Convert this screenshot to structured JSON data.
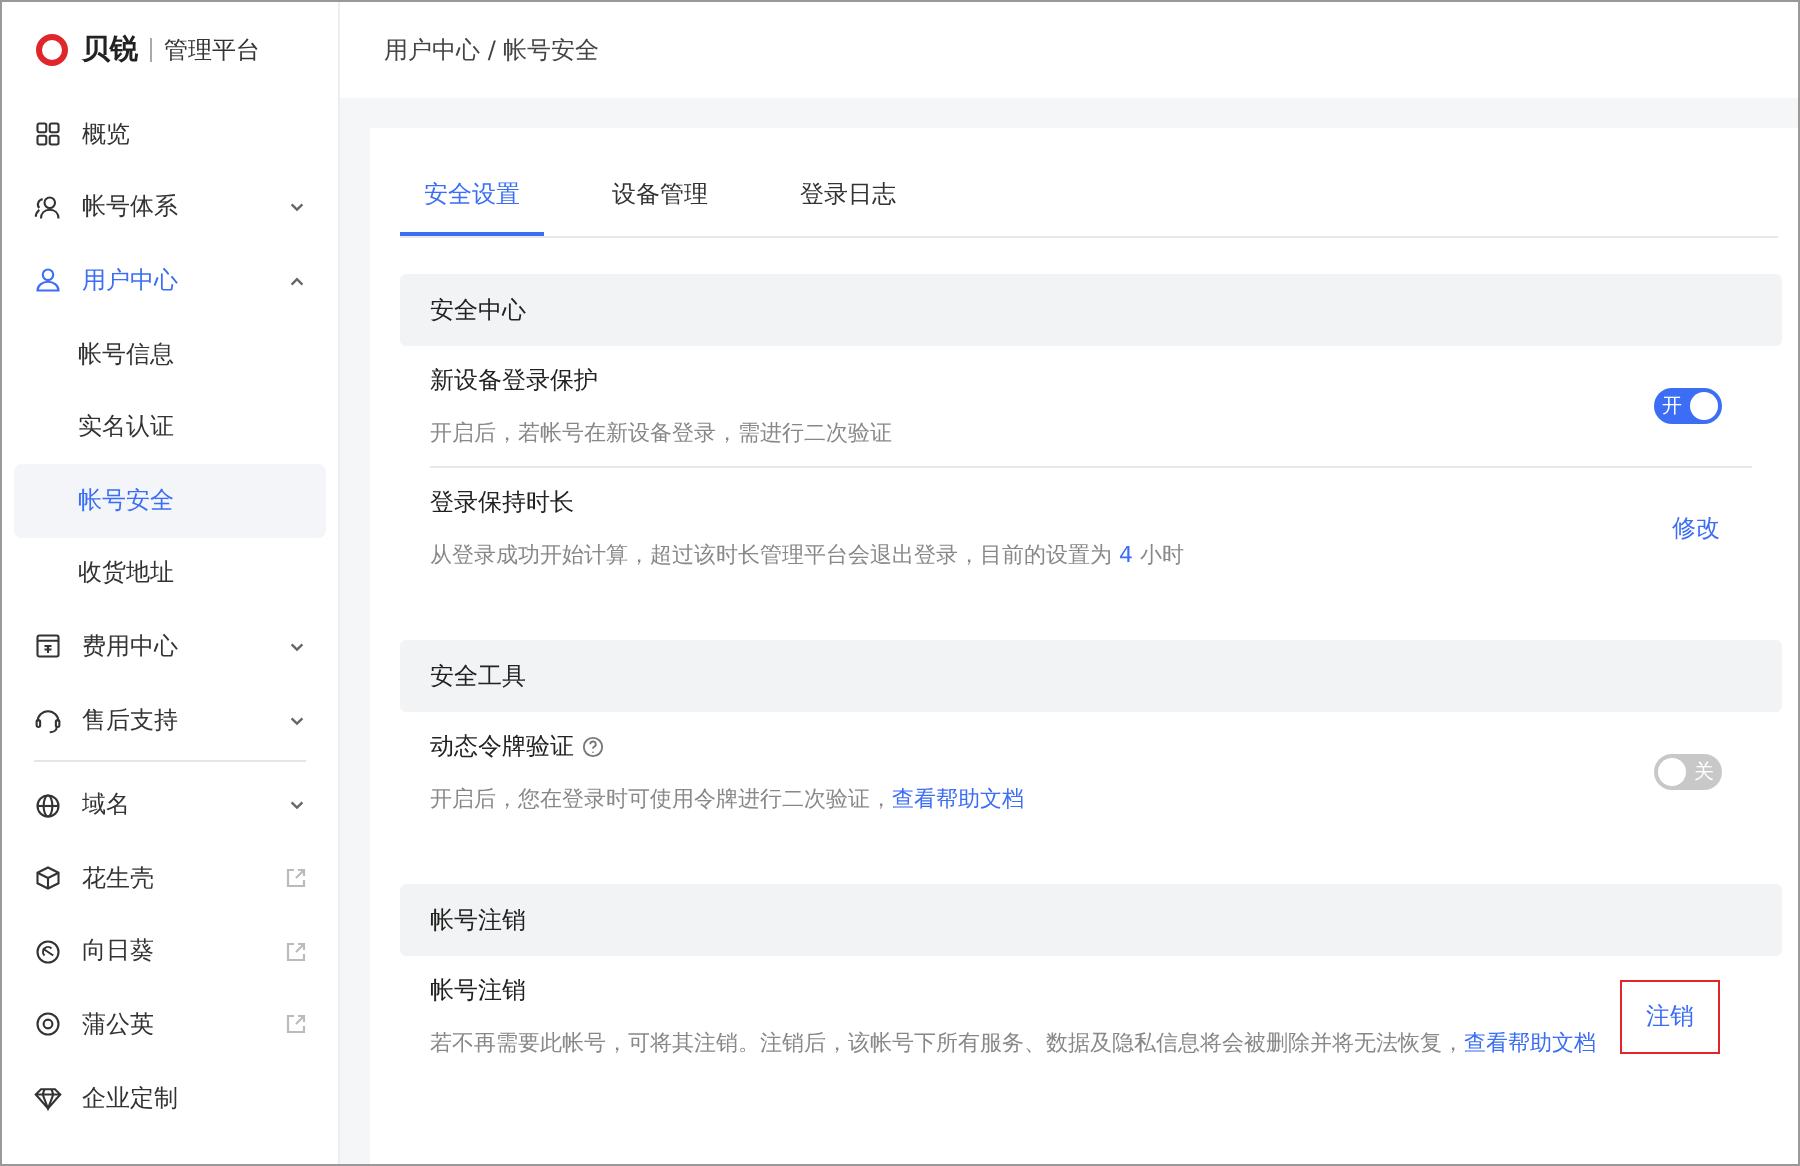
{
  "brand": {
    "name": "贝锐",
    "product": "管理平台"
  },
  "sidebar": {
    "sections": [
      [
        {
          "label": "概览",
          "kind": "plain",
          "selected": false
        },
        {
          "label": "帐号体系",
          "kind": "group",
          "expanded": false,
          "selected": false
        },
        {
          "label": "用户中心",
          "kind": "group",
          "expanded": true,
          "selected": true,
          "children": [
            {
              "label": "帐号信息",
              "selected": false
            },
            {
              "label": "实名认证",
              "selected": false
            },
            {
              "label": "帐号安全",
              "selected": true
            },
            {
              "label": "收货地址",
              "selected": false
            }
          ]
        },
        {
          "label": "费用中心",
          "kind": "group",
          "expanded": false,
          "selected": false
        },
        {
          "label": "售后支持",
          "kind": "group",
          "expanded": false,
          "selected": false
        }
      ],
      [
        {
          "label": "域名",
          "kind": "group",
          "expanded": false,
          "selected": false
        },
        {
          "label": "花生壳",
          "kind": "external",
          "selected": false
        },
        {
          "label": "向日葵",
          "kind": "external",
          "selected": false
        },
        {
          "label": "蒲公英",
          "kind": "external",
          "selected": false
        },
        {
          "label": "企业定制",
          "kind": "plain",
          "selected": false
        }
      ]
    ]
  },
  "breadcrumb": "用户中心 / 帐号安全",
  "tabs": [
    {
      "label": "安全设置",
      "selected": true
    },
    {
      "label": "设备管理",
      "selected": false
    },
    {
      "label": "登录日志",
      "selected": false
    }
  ],
  "sections": [
    {
      "title": "安全中心",
      "rows": [
        {
          "title": "新设备登录保护",
          "help_icon": false,
          "description": [
            {
              "kind": "text",
              "text": "开启后，若帐号在新设备登录，需进行二次验证"
            }
          ],
          "control": {
            "kind": "toggle",
            "on": true,
            "label": "开"
          }
        },
        {
          "title": "登录保持时长",
          "help_icon": false,
          "description": [
            {
              "kind": "text",
              "text": "从登录成功开始计算，超过该时长管理平台会退出登录，目前的设置为 "
            },
            {
              "kind": "value",
              "text": "4"
            },
            {
              "kind": "text",
              "text": " 小时"
            }
          ],
          "control": {
            "kind": "link",
            "label": "修改"
          }
        }
      ]
    },
    {
      "title": "安全工具",
      "rows": [
        {
          "title": "动态令牌验证",
          "help_icon": true,
          "description": [
            {
              "kind": "text",
              "text": "开启后，您在登录时可使用令牌进行二次验证，"
            },
            {
              "kind": "link",
              "text": "查看帮助文档"
            }
          ],
          "control": {
            "kind": "toggle",
            "on": false,
            "label": "关"
          }
        }
      ]
    },
    {
      "title": "帐号注销",
      "rows": [
        {
          "title": "帐号注销",
          "help_icon": false,
          "description": [
            {
              "kind": "text",
              "text": "若不再需要此帐号，可将其注销。注销后，该帐号下所有服务、数据及隐私信息将会被删除并将无法恢复，"
            },
            {
              "kind": "link",
              "text": "查看帮助文档"
            }
          ],
          "control": {
            "kind": "outlined",
            "label": "注销"
          }
        }
      ]
    }
  ]
}
